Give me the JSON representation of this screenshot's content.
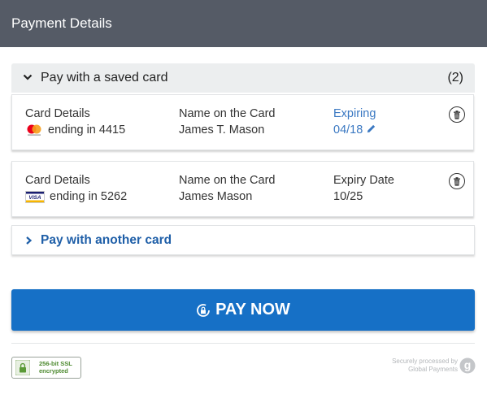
{
  "header": {
    "title": "Payment Details"
  },
  "saved": {
    "label": "Pay with a saved card",
    "count": "(2)",
    "cards": [
      {
        "details_label": "Card Details",
        "brand_icon": "mastercard-icon",
        "number": "ending in 4415",
        "name_label": "Name on the Card",
        "name": "James T. Mason",
        "expiry_label": "Expiring",
        "expiry": "04/18"
      },
      {
        "details_label": "Card Details",
        "brand_icon": "visa-icon",
        "brand_text": "VISA",
        "number": "ending in 5262",
        "name_label": "Name on the Card",
        "name": "James Mason",
        "expiry_label": "Expiry Date",
        "expiry": "10/25"
      }
    ]
  },
  "another": {
    "label": "Pay with another card"
  },
  "pay_button": {
    "label": "PAY NOW"
  },
  "ssl_badge": {
    "line1": "256-bit SSL",
    "line2": "encrypted"
  },
  "secure": {
    "line1": "Securely processed by",
    "line2": "Global Payments",
    "logo_letter": "g"
  },
  "colors": {
    "header_bg": "#555b66",
    "accent": "#1670c6",
    "expiring": "#3a78c2",
    "ssl_green": "#4d8a2f"
  }
}
